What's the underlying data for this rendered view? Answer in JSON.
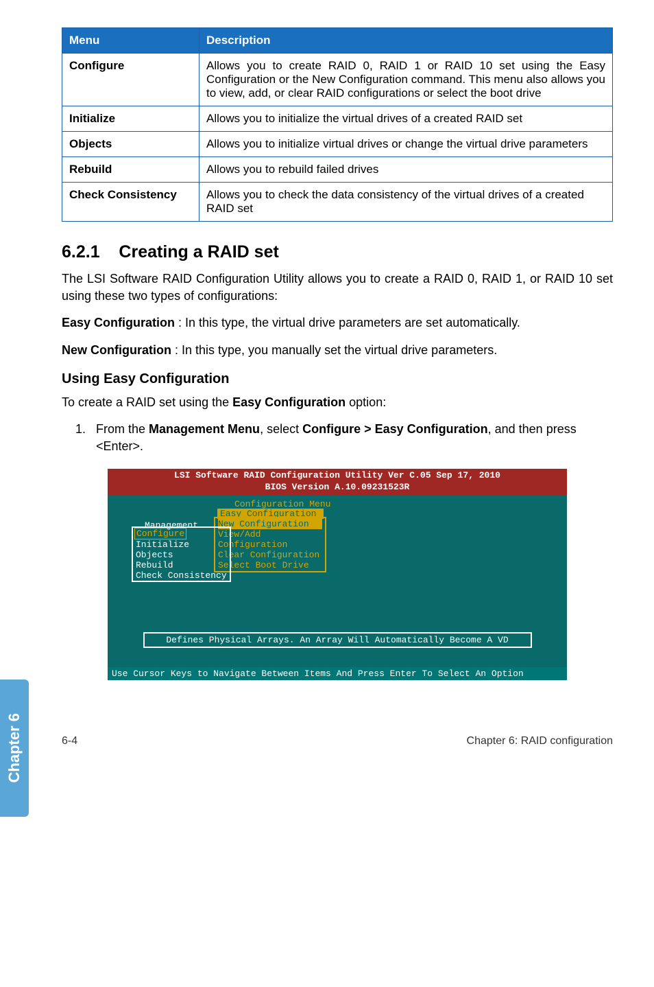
{
  "table": {
    "header": {
      "menu": "Menu",
      "desc": "Description"
    },
    "rows": [
      {
        "menu": "Configure",
        "desc": "Allows you to create RAID 0, RAID 1 or RAID 10 set using the Easy Configuration or the New Configuration command. This menu also allows you to view, add, or clear RAID configurations or select the boot drive"
      },
      {
        "menu": "Initialize",
        "desc": "Allows you to initialize the virtual drives of a created RAID set"
      },
      {
        "menu": "Objects",
        "desc": "Allows you to initialize virtual drives or change the virtual drive parameters"
      },
      {
        "menu": "Rebuild",
        "desc": "Allows you to rebuild failed drives"
      },
      {
        "menu": "Check Consistency",
        "desc": "Allows you to check the data consistency of the virtual drives of a created RAID set"
      }
    ]
  },
  "section": {
    "number": "6.2.1",
    "title": "Creating a RAID set",
    "intro": "The LSI Software RAID Configuration Utility allows you to create a RAID 0, RAID 1, or RAID 10 set using these two types of configurations:",
    "easy_label": "Easy Configuration",
    "easy_text": " : In this type, the virtual drive parameters are set automatically.",
    "new_label": "New Configuration",
    "new_text": " : In this type, you manually set the virtual drive parameters."
  },
  "using": {
    "heading": "Using Easy Configuration",
    "lead": "To create a RAID set using the ",
    "lead_bold": "Easy Configuration",
    "lead_tail": " option:",
    "step1_a": "From the ",
    "step1_b": "Management Menu",
    "step1_c": ", select ",
    "step1_d": "Configure > Easy Configuration",
    "step1_e": ", and then press <Enter>."
  },
  "bios": {
    "title1": "LSI Software RAID Configuration Utility Ver C.05 Sep 17, 2010",
    "title2": "BIOS Version   A.10.09231523R",
    "cfg_label": "Configuration Menu",
    "easy": "Easy Configuration",
    "new": "New Configuration",
    "view": "View/Add Configuration",
    "clear": "Clear Configuration",
    "boot": "Select Boot Drive",
    "mgmt_label": "Management",
    "m_configure": "Configure",
    "m_initialize": "Initialize",
    "m_objects": "Objects",
    "m_rebuild": "Rebuild",
    "m_check": "Check Consistency",
    "defines": "Defines Physical Arrays. An Array Will Automatically Become A VD",
    "footer": "Use Cursor Keys to Navigate Between Items And Press Enter To Select An Option"
  },
  "sidetab": "Chapter 6",
  "footer": {
    "left": "6-4",
    "right": "Chapter 6: RAID configuration"
  }
}
